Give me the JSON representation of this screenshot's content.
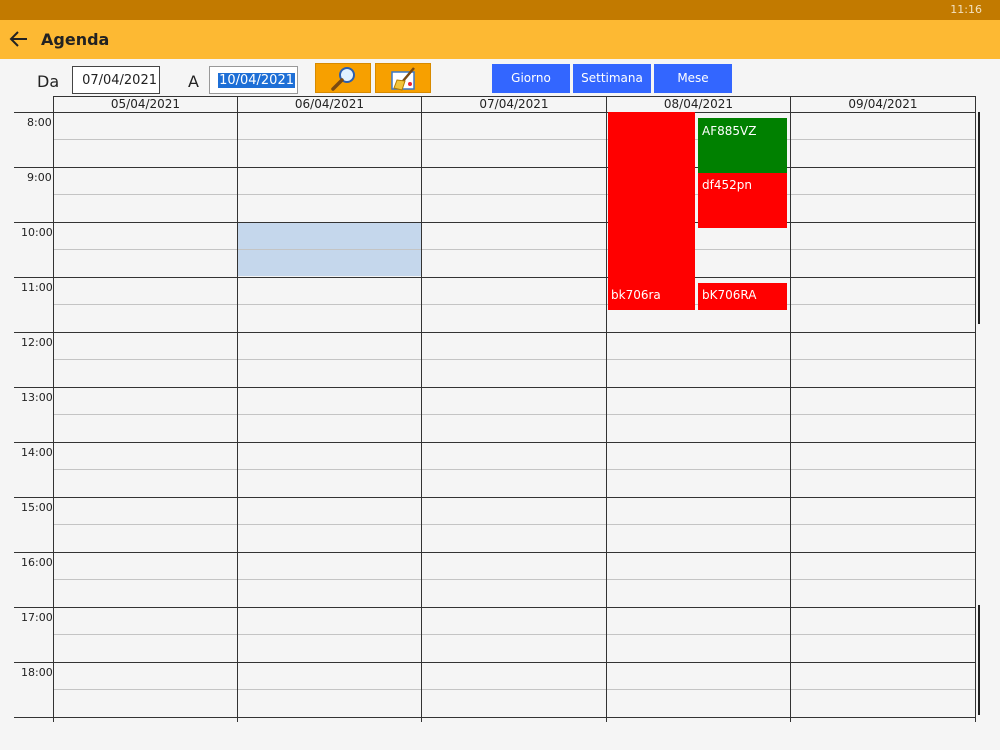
{
  "status": {
    "time": "11:16"
  },
  "app": {
    "title": "Agenda"
  },
  "filter": {
    "from_label": "Da",
    "from_value": "07/04/2021",
    "to_label": "A",
    "to_value": "10/04/2021"
  },
  "views": {
    "day": "Giorno",
    "week": "Settimana",
    "month": "Mese"
  },
  "calendar": {
    "columns": [
      "05/04/2021",
      "06/04/2021",
      "07/04/2021",
      "08/04/2021",
      "09/04/2021"
    ],
    "hours": [
      "8:00",
      "9:00",
      "10:00",
      "11:00",
      "12:00",
      "13:00",
      "14:00",
      "15:00",
      "16:00",
      "17:00",
      "18:00"
    ],
    "events": [
      {
        "label": "bk706ra",
        "color": "#ff0000"
      },
      {
        "label": "AF885VZ",
        "color": "#008000"
      },
      {
        "label": "df452pn",
        "color": "#ff0000"
      },
      {
        "label": "bK706RA",
        "color": "#ff0000"
      }
    ],
    "selection_color": "#c5d7ec"
  }
}
